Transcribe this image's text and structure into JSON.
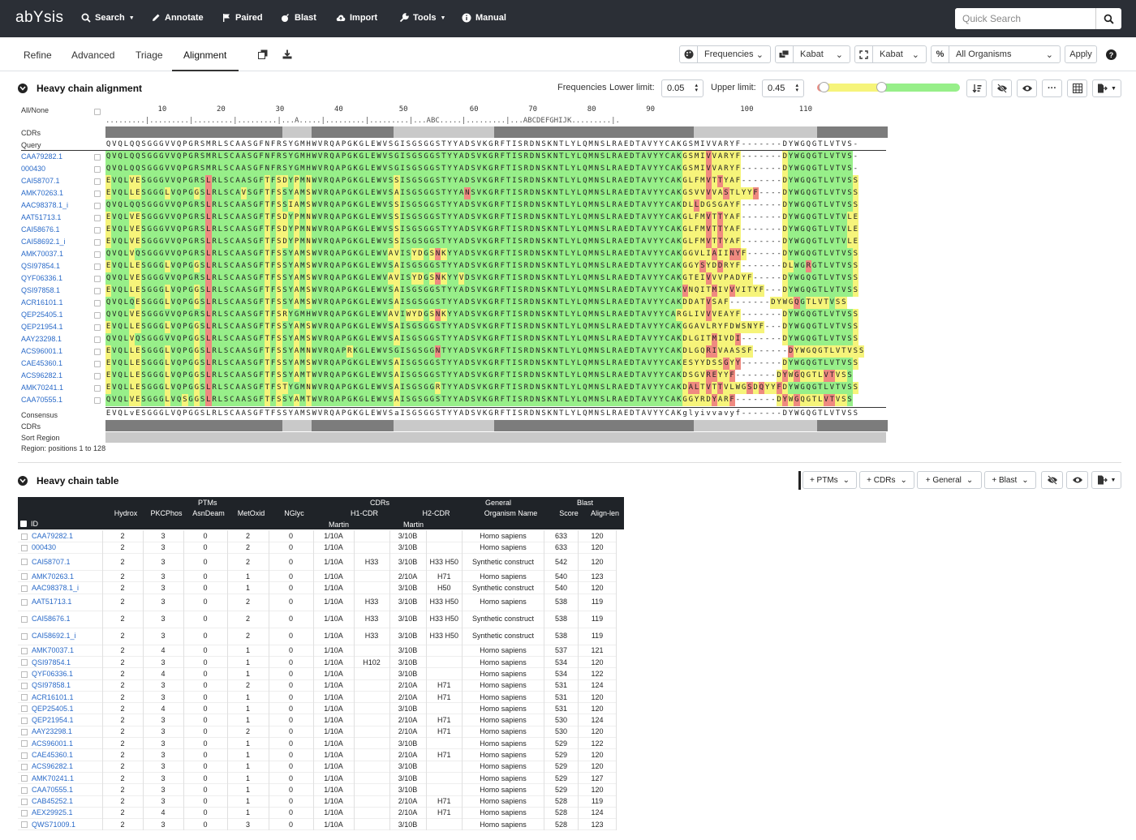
{
  "app": {
    "logo": "abYsis"
  },
  "topnav": [
    {
      "label": "Search",
      "icon": "search-icon",
      "caret": true
    },
    {
      "label": "Annotate",
      "icon": "pencil-icon",
      "caret": false
    },
    {
      "label": "Paired",
      "icon": "flag-icon",
      "caret": false
    },
    {
      "label": "Blast",
      "icon": "bomb-icon",
      "caret": false
    },
    {
      "label": "Import",
      "icon": "cloud-upload-icon",
      "caret": false
    },
    {
      "label": "Tools",
      "icon": "wrench-icon",
      "caret": true
    },
    {
      "label": "Manual",
      "icon": "info-circle-icon",
      "caret": false
    }
  ],
  "quick_search": {
    "placeholder": "Quick Search"
  },
  "subtabs": [
    {
      "label": "Refine",
      "active": false
    },
    {
      "label": "Advanced",
      "active": false
    },
    {
      "label": "Triage",
      "active": false
    },
    {
      "label": "Alignment",
      "active": true
    }
  ],
  "controls": {
    "colouring": "Frequencies",
    "numbering1": "Kabat",
    "numbering2": "Kabat",
    "organisms": "All Organisms",
    "apply": "Apply"
  },
  "alignment": {
    "title": "Heavy chain alignment",
    "freq_label": "Frequencies",
    "lower_label": "Lower limit:",
    "lower": "0.05",
    "upper_label": "Upper limit:",
    "upper": "0.45",
    "all_none": "All/None",
    "ruler_nums": [
      {
        "t": "10",
        "p": 10
      },
      {
        "t": "20",
        "p": 20
      },
      {
        "t": "30",
        "p": 30
      },
      {
        "t": "40",
        "p": 40
      },
      {
        "t": "50",
        "p": 50
      },
      {
        "t": "60",
        "p": 60
      },
      {
        "t": "70",
        "p": 70
      },
      {
        "t": "80",
        "p": 80
      },
      {
        "t": "90",
        "p": 90
      },
      {
        "t": "100",
        "p": 100
      },
      {
        "t": "110",
        "p": 110
      }
    ],
    "ruler_text": ".........|.........|.........|.........|...A.....|.........|.........|...ABC.....|.........|...ABCDEFGHIJK.........|.",
    "cdrs_label": "CDRs",
    "query_label": "Query",
    "query_seq": "QVQLQQSGGGVVQPGRSMRLSCAASGFNFRSYGMHWVRQAPGKGLEWVSGISGSGGSTYYADSVKGRFTISRDNSKNTLYLQMNSLRAEDTAVYYCAKGSMIVVARYF-------DYWGQGTLVTVS-",
    "rows": [
      {
        "id": "CAA79282.1",
        "seq": "QVQLQQSGGGVVQPGRSMRLSCAASGFNFRSYGMHWVRQAPGKGLEWVSGISGSGGSTYYADSVKGRFTISRDNSKNTLYLQMNSLRAEDTAVYYCAKGSMIVVARYF-------DYWGQGTLVTVS-"
      },
      {
        "id": "000430",
        "seq": "QVQLQQSGGGVVQPGRSMRLSCAASGFNFRSYGMHWVRQAPGKGLEWVSGISGSGGSTYYADSVKGRFTISRDNSKNTLYLQMNSLRAEDTAVYYCAKGSMIVVARYF-------DYWGQGTLVTVS-"
      },
      {
        "id": "CAI58707.1",
        "seq": "EVQLVESGGGVVQPGRSLRLSCAASGFTFSDYPMNWVRQAPGKGLEWVSSISGSGGSTYYADSVKGRFTISRDNSKNTLYLQMNSLRAEDTAVYYCAKGLFMVTTYAF-------DYWGQGTLVTVSS"
      },
      {
        "id": "AMK70263.1",
        "seq": "EVQLLESGGGLVQPGGSLRLSCAVSGFTFSSYAMSWVRQAPGKGLEWVSAISGSGGSTYYANSVKGRFTISRDNSKNTLYLQMNSLRAEDTAVYYCAKGSVVVVASTLYYF----DYWGQGTLVTVSS"
      },
      {
        "id": "AAC98378.1_i",
        "seq": "QVQLQQSGGGVVQPGRSLRLSCAASGFTFSSIAMSWVRQAPGKGLEWVSSISGSGGSTYYADSVKGRFTISRDNSKNTLYLQMNSLRAEDTAVYYCAKDLLDGSGAYF-------DYWGQGTLVTVSS"
      },
      {
        "id": "AAT51713.1",
        "seq": "EVQLVESGGGVVQPGRSLRLSCAASGFTFSDYPMNWVRQAPGKGLEWVSSISGSGGSTYYADSVKGRFTISRDNSKNTLYLQMNSLRAEDTAVYYCAKGLFMVTTYAF-------DYWGQGTLVTVLE"
      },
      {
        "id": "CAI58676.1",
        "seq": "EVQLVESGGGVVQPGRSLRLSCAASGFTFSDYPMNWVRQAPGKGLEWVSSISGSGGSTYYADSVKGRFTISRDNSKNTLYLQMNSLRAEDTAVYYCAKGLFMVTTYAF-------DYWGQGTLVTVLE"
      },
      {
        "id": "CAI58692.1_i",
        "seq": "EVQLVESGGGVVQPGRSLRLSCAASGFTFSDYPMNWVRQAPGKGLEWVSSISGSGGSTYYADSVKGRFTISRDNSKNTLYLQMNSLRAEDTAVYYCAKGLFMVTTYAF-------DYWGQGTLVTVLE"
      },
      {
        "id": "AMK70037.1",
        "seq": "QVQLVQSGGGVVQPGRSLRLSCAASGFTFSSYAMSWVRQAPGKGLEWVAVISYDGSNKYYADSVKGRFTISRDNSKNTLYLQMNSLRAEDTAVYYCAKGGVLIAIINYF------DYWGQGTLVTVSS"
      },
      {
        "id": "QSI97854.1",
        "seq": "EVQLLESGGGLVQPGGSLRLSCAASGFTFSSYAMSWVRQAPGKGLEWVSAISGSGGSTYYADSVKGRFTISRDNSKNTLYLQMNSLRAEDTAVYYCAKGGYSYDDRYF-------DLWGRGTLVTVSS"
      },
      {
        "id": "QYF06336.1",
        "seq": "QVQLVESGGGVVQPGRSLRLSCAASGFTFSSYAMSWVRQAPGKGLEWVAVISYDGSNKYYVDSVKGRFTISRDNSKNTLYLQMNSLRAEDTAVYYCAKGTEIVVVPADYF-----DYWGQGTLVTVSS"
      },
      {
        "id": "QSI97858.1",
        "seq": "EVQLLESGGGLVQPGGSLRLSCAASGFTFSSYAMSWVRQAPGKGLEWVSAISGSGGSTYYADSVKGRFTISRDNSKNTLYLQMNSLRAEDTAVYYCAKVNQITMIVVVITYF---DYWGQGTLVTVSS"
      },
      {
        "id": "ACR16101.1",
        "seq": "QVQLQESGGGLVQPGGSLRLSCAASGFTFSSYAMSWVRQAPGKGLEWVSAISGSGGSTYYADSVKGRFTISRDNSKNTLYLQMNSLRAEDTAVYYCAKDDATVSAF-------DYWGQGTLVTVSS"
      },
      {
        "id": "QEP25405.1",
        "seq": "QVQLVESGGGVVQPGRSLRLSCAASGFTFSRYGMHWVRQAPGKGLEWVAVIWYDGSNKYYADSVKGRFTISRDNSKNTLYLQMNSLRAEDTAVYYCARGLIVVVEAYF-------DYWGQGTLVTVSS"
      },
      {
        "id": "QEP21954.1",
        "seq": "EVQLLESGGGLVQPGGSLRLSCAASGFTFSSYAMSWVRQAPGKGLEWVSAISGSGGSTYYADSVKGRFTISRDNSKNTLYLQMNSLRAEDTAVYYCAKGGAVLRYFDWSNYF---DYWGQGTLVTVSS"
      },
      {
        "id": "AAY23298.1",
        "seq": "QVQLVQSGGGVVQPGGSLRLSCAASGFTFSSYAMSWVRQAPGKGLEWVSAISGSGGSTYYADSVKGRFTISRDNSKNTLYLQMNSLRAEDTAVYYCAKDLGITMIVDI-------DYWGQGTLVTVSS"
      },
      {
        "id": "ACS96001.1",
        "seq": "EVQLLESGGGLVQPGGSLRLSCAASGFTFSSYAMNWVRQAPRKGLEWVSGISGSGGNTYYADSVKGRFTISRDNSKNTLYLQMNSLRAEDTAVYYCAKDLGQRIVAASSF------DYWGQGTLVTVSS"
      },
      {
        "id": "CAE45360.1",
        "seq": "EVQLLESGGGLVQPGGSLRLSCAASGFTFSSYAMSWVRQAPGKGLEWVSAISGSGGSTYYADSVKGRFTISRDNSKNTLYLQMNSLRAEDTAVYYCAKESYYDSSGYY-------DYWGQGTLVTVSS"
      },
      {
        "id": "ACS96282.1",
        "seq": "EVQLLESGGGLVQPGGSLRLSCAASGFTFSSYAMTWVRQAPGKGLEWVSAISGSGGSTYYADSVKGRFTISRDNSKNTLYLQMNSLRAEDTAVYYCAKDSGVREYYF-------DYWGQGTLVTVSS"
      },
      {
        "id": "AMK70241.1",
        "seq": "EVQLLESGGGLVQPGGSLRLSCAASGFTFSTYGMNWVRQAPGKGLEWVSAISGSGGRTYYADSVKGRFTISRDNSKNTLYLQMNSLRAEDTAVYYCAKDALTVTTVLWGSDQYYFDYWGQGTLVTVSS"
      },
      {
        "id": "CAA70555.1",
        "seq": "QVQLVESGGGLVQSGGSLRLSCAASGFTFSSYAMTWVRQAPGKGLEWVSAISGSGGSTYYADSVKGRFTISRDNSKNTLYLQMNSLRAEDTAVYYCAKGGYRDYARF-------DYWGQGTLVTVSS"
      }
    ],
    "consensus_label": "Consensus",
    "consensus_seq": "EVQLvESGGGLVQPGGSLRLSCAASGFTFSSYAMSWVRQAPGKGLEWVSaISGSGGSTYYADSVKGRFTISRDNSKNTLYLQMNSLRAEDTAVYYCAKglyivvavyf-------DYWGQGTLVTVSS",
    "cdrs_label2": "CDRs",
    "sort_label": "Sort Region",
    "region_label": "Region: positions 1 to 128"
  },
  "table": {
    "title": "Heavy chain table",
    "buttons": [
      "+ PTMs",
      "+ CDRs",
      "+ General",
      "+ Blast"
    ],
    "groups": [
      {
        "label": "PTMs"
      },
      {
        "label": "CDRs"
      },
      {
        "label": "General"
      },
      {
        "label": "Blast"
      }
    ],
    "cols": [
      "Hydrox",
      "PKCPhos",
      "AsnDeam",
      "MetOxid",
      "NGlyc",
      "H1-CDR",
      "H2-CDR",
      "Organism Name",
      "Score",
      "Align-len"
    ],
    "sub": {
      "h1": "Martin",
      "h2": "Martin"
    },
    "id_label": "ID",
    "rows": [
      {
        "id": "CAA79282.1",
        "v": [
          "2",
          "3",
          "0",
          "2",
          "0",
          "1/10A",
          "",
          "3/10B",
          "",
          "Homo sapiens",
          "633",
          "120"
        ]
      },
      {
        "id": "000430",
        "v": [
          "2",
          "3",
          "0",
          "2",
          "0",
          "1/10A",
          "",
          "3/10B",
          "",
          "Homo sapiens",
          "633",
          "120"
        ]
      },
      {
        "id": "CAI58707.1",
        "v": [
          "2",
          "3",
          "0",
          "2",
          "0",
          "1/10A",
          "H33",
          "3/10B",
          "H33 H50",
          "Synthetic construct",
          "542",
          "120"
        ]
      },
      {
        "id": "AMK70263.1",
        "v": [
          "2",
          "3",
          "0",
          "1",
          "0",
          "1/10A",
          "",
          "2/10A",
          "H71",
          "Homo sapiens",
          "540",
          "123"
        ]
      },
      {
        "id": "AAC98378.1_i",
        "v": [
          "2",
          "3",
          "0",
          "1",
          "0",
          "1/10A",
          "",
          "3/10B",
          "H50",
          "Synthetic construct",
          "540",
          "120"
        ]
      },
      {
        "id": "AAT51713.1",
        "v": [
          "2",
          "3",
          "0",
          "2",
          "0",
          "1/10A",
          "H33",
          "3/10B",
          "H33 H50",
          "Homo sapiens",
          "538",
          "119"
        ]
      },
      {
        "id": "CAI58676.1",
        "v": [
          "2",
          "3",
          "0",
          "2",
          "0",
          "1/10A",
          "H33",
          "3/10B",
          "H33 H50",
          "Synthetic construct",
          "538",
          "119"
        ]
      },
      {
        "id": "CAI58692.1_i",
        "v": [
          "2",
          "3",
          "0",
          "2",
          "0",
          "1/10A",
          "H33",
          "3/10B",
          "H33 H50",
          "Synthetic construct",
          "538",
          "119"
        ]
      },
      {
        "id": "AMK70037.1",
        "v": [
          "2",
          "4",
          "0",
          "1",
          "0",
          "1/10A",
          "",
          "3/10B",
          "",
          "Homo sapiens",
          "537",
          "121"
        ]
      },
      {
        "id": "QSI97854.1",
        "v": [
          "2",
          "3",
          "0",
          "1",
          "0",
          "1/10A",
          "H102",
          "3/10B",
          "",
          "Homo sapiens",
          "534",
          "120"
        ]
      },
      {
        "id": "QYF06336.1",
        "v": [
          "2",
          "4",
          "0",
          "1",
          "0",
          "1/10A",
          "",
          "3/10B",
          "",
          "Homo sapiens",
          "534",
          "122"
        ]
      },
      {
        "id": "QSI97858.1",
        "v": [
          "2",
          "3",
          "0",
          "2",
          "0",
          "1/10A",
          "",
          "2/10A",
          "H71",
          "Homo sapiens",
          "531",
          "124"
        ]
      },
      {
        "id": "ACR16101.1",
        "v": [
          "2",
          "3",
          "0",
          "1",
          "0",
          "1/10A",
          "",
          "2/10A",
          "H71",
          "Homo sapiens",
          "531",
          "120"
        ]
      },
      {
        "id": "QEP25405.1",
        "v": [
          "2",
          "4",
          "0",
          "1",
          "0",
          "1/10A",
          "",
          "3/10B",
          "",
          "Homo sapiens",
          "531",
          "120"
        ]
      },
      {
        "id": "QEP21954.1",
        "v": [
          "2",
          "3",
          "0",
          "1",
          "0",
          "1/10A",
          "",
          "2/10A",
          "H71",
          "Homo sapiens",
          "530",
          "124"
        ]
      },
      {
        "id": "AAY23298.1",
        "v": [
          "2",
          "3",
          "0",
          "2",
          "0",
          "1/10A",
          "",
          "2/10A",
          "H71",
          "Homo sapiens",
          "530",
          "120"
        ]
      },
      {
        "id": "ACS96001.1",
        "v": [
          "2",
          "3",
          "0",
          "1",
          "0",
          "1/10A",
          "",
          "3/10B",
          "",
          "Homo sapiens",
          "529",
          "122"
        ]
      },
      {
        "id": "CAE45360.1",
        "v": [
          "2",
          "3",
          "0",
          "1",
          "0",
          "1/10A",
          "",
          "2/10A",
          "H71",
          "Homo sapiens",
          "529",
          "120"
        ]
      },
      {
        "id": "ACS96282.1",
        "v": [
          "2",
          "3",
          "0",
          "1",
          "0",
          "1/10A",
          "",
          "3/10B",
          "",
          "Homo sapiens",
          "529",
          "120"
        ]
      },
      {
        "id": "AMK70241.1",
        "v": [
          "2",
          "3",
          "0",
          "1",
          "0",
          "1/10A",
          "",
          "3/10B",
          "",
          "Homo sapiens",
          "529",
          "127"
        ]
      },
      {
        "id": "CAA70555.1",
        "v": [
          "2",
          "3",
          "0",
          "1",
          "0",
          "1/10A",
          "",
          "3/10B",
          "",
          "Homo sapiens",
          "529",
          "120"
        ]
      },
      {
        "id": "CAB45252.1",
        "v": [
          "2",
          "3",
          "0",
          "1",
          "0",
          "1/10A",
          "",
          "2/10A",
          "H71",
          "Homo sapiens",
          "528",
          "119"
        ]
      },
      {
        "id": "AEX29925.1",
        "v": [
          "2",
          "4",
          "0",
          "1",
          "0",
          "1/10A",
          "",
          "2/10A",
          "H71",
          "Homo sapiens",
          "528",
          "124"
        ]
      },
      {
        "id": "QWS71009.1",
        "v": [
          "2",
          "3",
          "0",
          "3",
          "0",
          "1/10A",
          "",
          "3/10B",
          "",
          "Homo sapiens",
          "528",
          "123"
        ]
      }
    ]
  },
  "colors": {
    "conserved": "#97ef89",
    "common": "#f6f47a",
    "rare": "#ef8a80",
    "query": "#ffffff",
    "link": "#2a6ac8",
    "topbar": "#2b2f36"
  }
}
